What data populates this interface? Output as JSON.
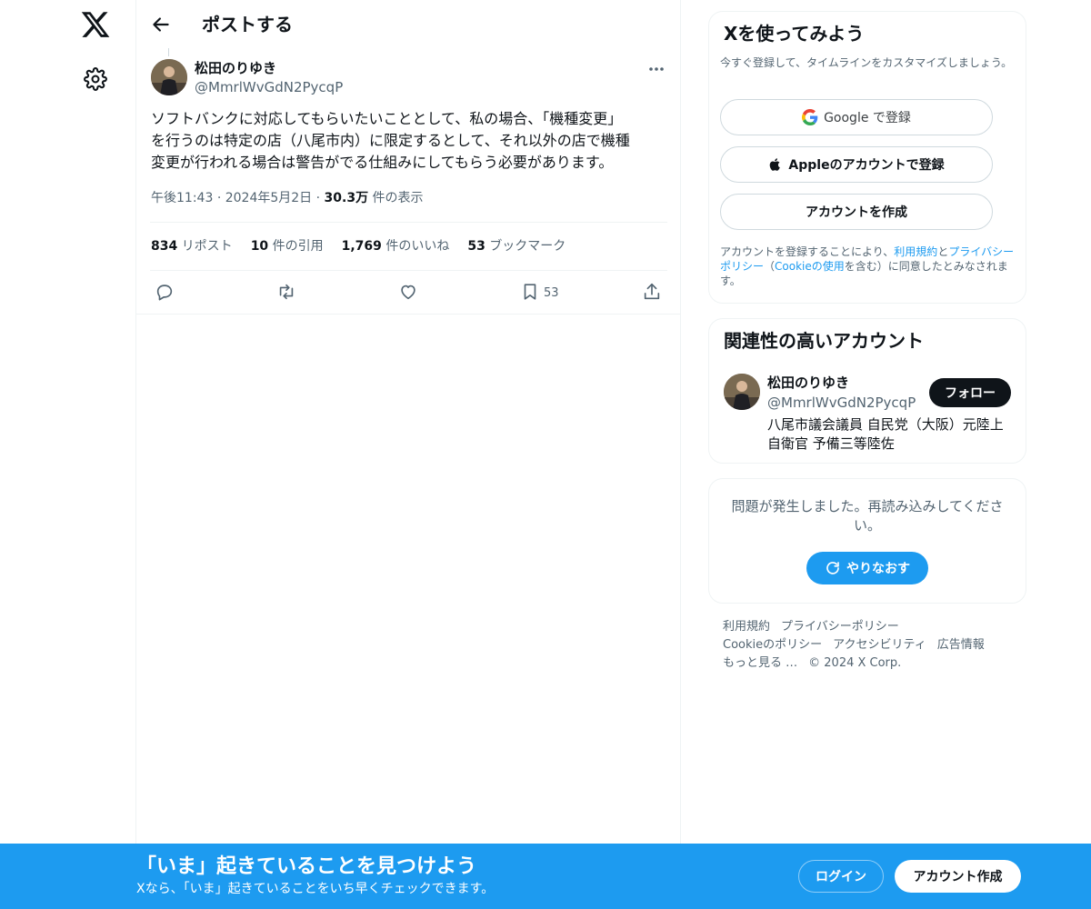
{
  "header": {
    "title": "ポストする"
  },
  "icons": {
    "logo": "x-logo-icon",
    "settings": "gear-icon",
    "back": "arrow-left-icon",
    "more": "more-dots-icon",
    "reply": "reply-icon",
    "repost": "repost-icon",
    "like": "heart-icon",
    "bookmark": "bookmark-icon",
    "share": "share-icon",
    "google": "google-icon",
    "apple": "apple-icon",
    "refresh": "refresh-icon"
  },
  "post": {
    "author_name": "松田のりゆき",
    "author_handle": "@MmrlWvGdN2PycqP",
    "text_line1": "ソフトバンクに対応してもらいたいこととして、私の場合、「機種変更」",
    "text_line2": "を行うのは特定の店（八尾市内）に限定するとして、それ以外の店で機種",
    "text_line3": "変更が行われる場合は警告がでる仕組みにしてもらう必要があります。",
    "time": "午後11:43",
    "dot1": "·",
    "date": "2024年5月2日",
    "dot2": "·",
    "views_count": "30.3万",
    "views_label": "件の表示",
    "stats": {
      "reposts_count": "834",
      "reposts_label": "リポスト",
      "quotes_count": "10",
      "quotes_label": "件の引用",
      "likes_count": "1,769",
      "likes_label": "件のいいね",
      "bookmarks_count": "53",
      "bookmarks_label": "ブックマーク"
    },
    "bookmark_action_count": "53"
  },
  "signup_card": {
    "title": "Xを使ってみよう",
    "subtitle": "今すぐ登録して、タイムラインをカスタマイズしましょう。",
    "google_label": "Google で登録",
    "apple_label": "Appleのアカウントで登録",
    "create_label": "アカウントを作成",
    "legal_1": "アカウントを登録することにより、",
    "legal_terms": "利用規約",
    "legal_2": "と",
    "legal_privacy": "プライバシーポリシー",
    "legal_3": "（",
    "legal_cookie": "Cookieの使用",
    "legal_4": "を含む）に同意したとみなされます。"
  },
  "related_card": {
    "title": "関連性の高いアカウント",
    "name": "松田のりゆき",
    "handle": "@MmrlWvGdN2PycqP",
    "follow_label": "フォロー",
    "bio_line1": "八尾市議会議員 自民党（大阪）元陸上",
    "bio_line2": "自衛官 予備三等陸佐"
  },
  "error_card": {
    "message": "問題が発生しました。再読み込みしてください。",
    "retry_label": "やりなおす"
  },
  "footer": {
    "terms": "利用規約",
    "privacy": "プライバシーポリシー",
    "cookie": "Cookieのポリシー",
    "accessibility": "アクセシビリティ",
    "ads": "広告情報",
    "more": "もっと見る …",
    "copyright": "© 2024 X Corp."
  },
  "banner": {
    "title": "「いま」起きていることを見つけよう",
    "subtitle": "Xなら、「いま」起きていることをいち早くチェックできます。",
    "login_label": "ログイン",
    "signup_label": "アカウント作成"
  },
  "colors": {
    "accent": "#1d9bf0",
    "text": "#0f1419",
    "muted": "#536471",
    "border": "#eff3f4"
  }
}
